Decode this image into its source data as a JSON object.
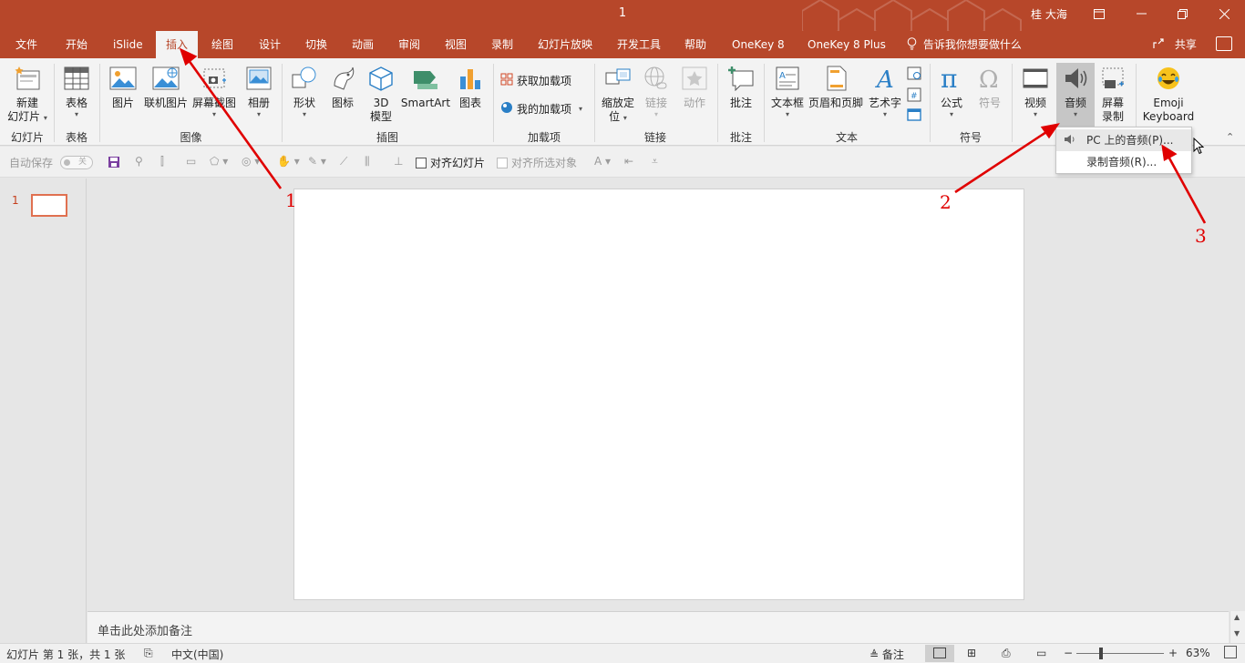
{
  "title_bar": {
    "doc_title": "1",
    "user": "桂 大海",
    "ribbon_display_icon": "ribbon-display-icon",
    "minimize_icon": "minimize-icon",
    "restore_icon": "restore-icon",
    "close_icon": "close-icon"
  },
  "tabs": [
    {
      "label": "文件"
    },
    {
      "label": "开始"
    },
    {
      "label": "iSlide"
    },
    {
      "label": "插入"
    },
    {
      "label": "绘图"
    },
    {
      "label": "设计"
    },
    {
      "label": "切换"
    },
    {
      "label": "动画"
    },
    {
      "label": "审阅"
    },
    {
      "label": "视图"
    },
    {
      "label": "录制"
    },
    {
      "label": "幻灯片放映"
    },
    {
      "label": "开发工具"
    },
    {
      "label": "帮助"
    },
    {
      "label": "OneKey 8"
    },
    {
      "label": "OneKey 8 Plus"
    }
  ],
  "tell_me": "告诉我你想要做什么",
  "share": "共享",
  "ribbon": {
    "new_slide": {
      "line1": "新建",
      "line2": "幻灯片"
    },
    "table": "表格",
    "pictures": "图片",
    "online_pictures": "联机图片",
    "screenshot": "屏幕截图",
    "album": "相册",
    "shapes": "形状",
    "icons": "图标",
    "model3d": {
      "line1": "3D",
      "line2": "模型"
    },
    "smartart": "SmartArt",
    "chart": "图表",
    "get_addins": "获取加载项",
    "my_addins": "我的加载项",
    "zoom": {
      "line1": "缩放定",
      "line2": "位"
    },
    "link": "链接",
    "action": "动作",
    "comment": "批注",
    "textbox": "文本框",
    "header_footer": "页眉和页脚",
    "wordart": "艺术字",
    "equation": "公式",
    "symbol": "符号",
    "video": "视频",
    "audio": "音频",
    "screen_recording": {
      "line1": "屏幕",
      "line2": "录制"
    },
    "emoji": {
      "line1": "Emoji",
      "line2": "Keyboard"
    },
    "groups": {
      "slides": "幻灯片",
      "tables": "表格",
      "images": "图像",
      "illustrations": "插图",
      "addins": "加载项",
      "links": "链接",
      "comments": "批注",
      "text": "文本",
      "symbols": "符号"
    }
  },
  "qat": {
    "autosave": "自动保存",
    "autosave_state": "关",
    "align_slides": "对齐幻灯片",
    "align_selected": "对齐所选对象"
  },
  "slide_pane": {
    "slide_number": "1"
  },
  "notes_placeholder": "单击此处添加备注",
  "status_bar": {
    "slide_info": "幻灯片 第 1 张，共 1 张",
    "language": "中文(中国)",
    "notes": "备注",
    "zoom": "63%"
  },
  "audio_menu": {
    "pc_audio": "PC 上的音频(P)...",
    "record_audio": "录制音频(R)..."
  },
  "annotations": [
    "1",
    "2",
    "3"
  ],
  "colors": {
    "accent": "#b7472a",
    "annotation": "#e00000"
  }
}
